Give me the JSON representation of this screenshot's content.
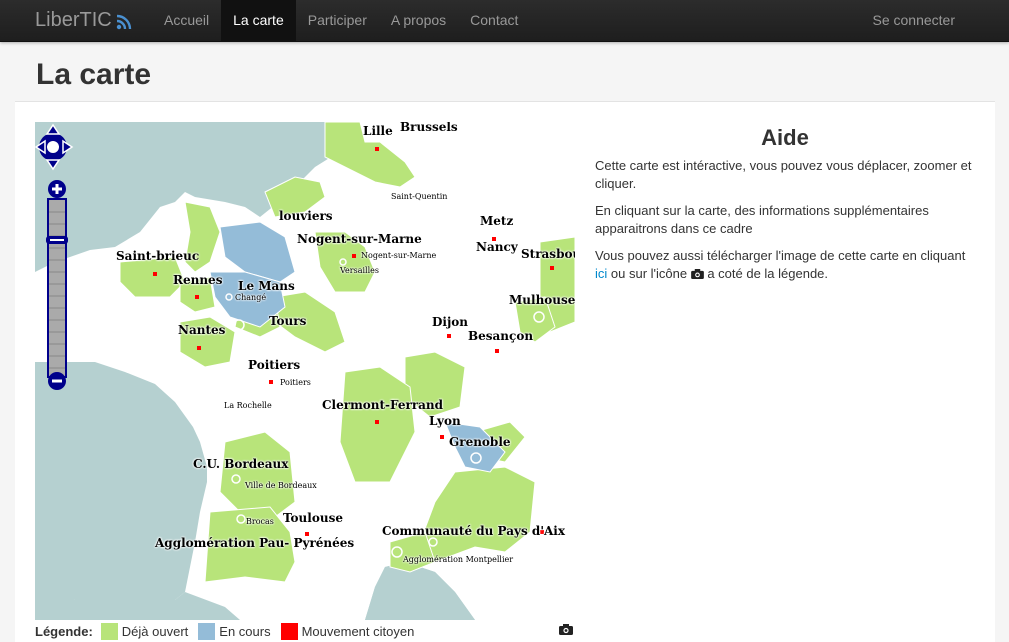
{
  "navbar": {
    "brand": "LiberTIC",
    "links": [
      "Accueil",
      "La carte",
      "Participer",
      "A propos",
      "Contact"
    ],
    "login": "Se connecter"
  },
  "page": {
    "title": "La carte"
  },
  "map": {
    "cities": {
      "brussels": "Brussels",
      "lille": "Lille",
      "saint_quentin": "Saint-Quentin",
      "metz": "Metz",
      "nancy": "Nancy",
      "strasbourg": "Strasbou",
      "mulhouse": "Mulhouse",
      "louviers": "louviers",
      "nogent_big": "Nogent-sur-Marne",
      "nogent_small": "Nogent-sur-Marne",
      "versailles": "Versailles",
      "saint_brieuc": "Saint-brieuc",
      "rennes": "Rennes",
      "le_mans": "Le Mans",
      "change": "Changé",
      "tours": "Tours",
      "nantes": "Nantes",
      "dijon": "Dijon",
      "besancon": "Besançon",
      "poitiers_big": "Poitiers",
      "poitiers_small": "Poitiers",
      "la_rochelle": "La Rochelle",
      "clermont": "Clermont-Ferrand",
      "lyon": "Lyon",
      "grenoble": "Grenoble",
      "cu_bordeaux": "C.U. Bordeaux",
      "ville_bordeaux": "Ville de Bordeaux",
      "brocas": "Brocas",
      "toulouse": "Toulouse",
      "pau": "Agglomération Pau- Pyrénées",
      "pays_aix": "Communauté du Pays d'Aix",
      "montpellier": "Agglomération Montpellier"
    },
    "colors": {
      "sea": "#b5d0d0",
      "land": "#ffffff",
      "open": "#b8e47a",
      "in_progress": "#94bcd8",
      "citizen": "#ff0000"
    }
  },
  "legend": {
    "title": "Légende:",
    "items": [
      "Déjà ouvert",
      "En cours",
      "Mouvement citoyen"
    ]
  },
  "aide": {
    "title": "Aide",
    "p1": "Cette carte est intéractive, vous pouvez vous déplacer, zoomer et cliquer.",
    "p2": "En cliquant sur la carte, des informations supplémentaires apparaitrons dans ce cadre",
    "p3_a": "Vous pouvez aussi télécharger l'image de cette carte en cliquant ",
    "p3_link": "ici",
    "p3_b": " ou sur l'icône ",
    "p3_c": " a coté de la légende."
  }
}
